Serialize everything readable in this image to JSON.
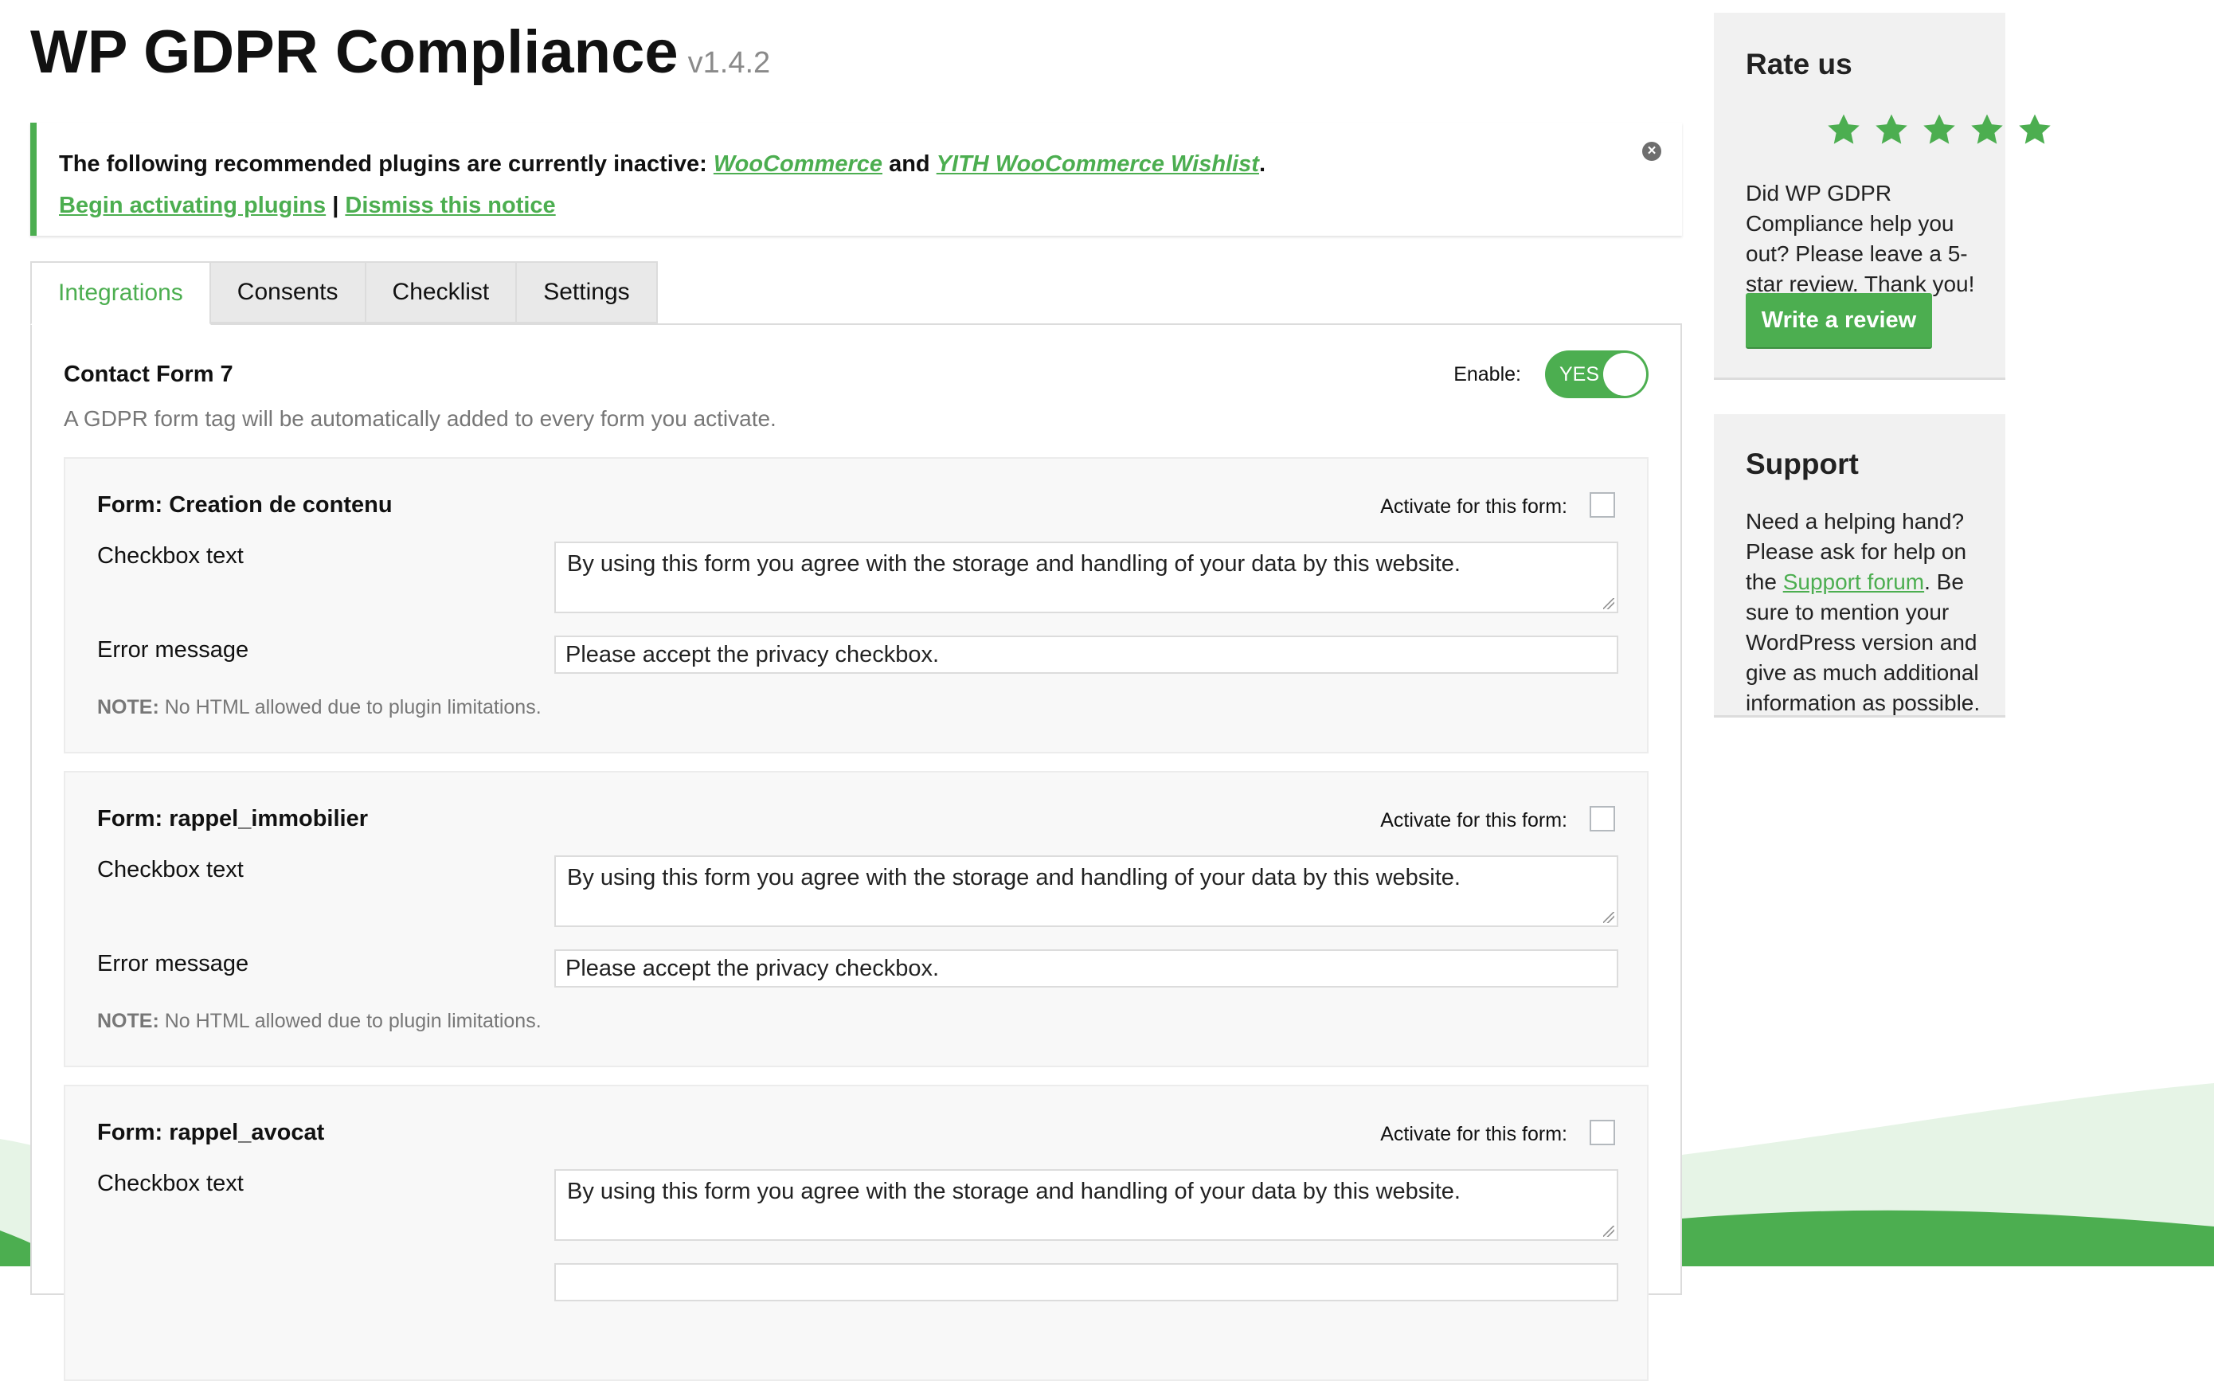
{
  "header": {
    "title": "WP GDPR Compliance",
    "version": "v1.4.2"
  },
  "notice": {
    "text_before": "The following recommended plugins are currently inactive: ",
    "plugin1": "WooCommerce",
    "and": " and ",
    "plugin2": "YITH WooCommerce Wishlist",
    "period": ".",
    "begin_link": "Begin activating plugins",
    "separator": " | ",
    "dismiss_link": "Dismiss this notice"
  },
  "tabs": [
    {
      "label": "Integrations",
      "active": true
    },
    {
      "label": "Consents",
      "active": false
    },
    {
      "label": "Checklist",
      "active": false
    },
    {
      "label": "Settings",
      "active": false
    }
  ],
  "integration": {
    "title": "Contact Form 7",
    "description": "A GDPR form tag will be automatically added to every form you activate.",
    "enable_label": "Enable:",
    "toggle_value": "YES",
    "enabled": true
  },
  "forms": [
    {
      "title": "Form: Creation de contenu",
      "activate_label": "Activate for this form:",
      "activated": false,
      "checkbox_label": "Checkbox text",
      "checkbox_text": "By using this form you agree with the storage and handling of your data by this website.",
      "error_label": "Error message",
      "error_text": "Please accept the privacy checkbox.",
      "note_prefix": "NOTE:",
      "note_text": " No HTML allowed due to plugin limitations."
    },
    {
      "title": "Form: rappel_immobilier",
      "activate_label": "Activate for this form:",
      "activated": false,
      "checkbox_label": "Checkbox text",
      "checkbox_text": "By using this form you agree with the storage and handling of your data by this website.",
      "error_label": "Error message",
      "error_text": "Please accept the privacy checkbox.",
      "note_prefix": "NOTE:",
      "note_text": " No HTML allowed due to plugin limitations."
    },
    {
      "title": "Form: rappel_avocat",
      "activate_label": "Activate for this form:",
      "activated": false,
      "checkbox_label": "Checkbox text",
      "checkbox_text": "By using this form you agree with the storage and handling of your data by this website."
    }
  ],
  "sidebar": {
    "rate": {
      "title": "Rate us",
      "stars": 5,
      "text": "Did WP GDPR Compliance help you out? Please leave a 5-star review. Thank you!",
      "button": "Write a review"
    },
    "support": {
      "title": "Support",
      "text_before": "Need a helping hand? Please ask for help on the ",
      "link": "Support forum",
      "text_after": ". Be sure to mention your WordPress version and give as much additional information as possible."
    }
  },
  "icons": {
    "notice_close": "close-circle-icon",
    "star": "star-icon",
    "resize": "resize-grip-icon"
  },
  "colors": {
    "accent": "#4cae50",
    "wave_light": "#e4f3e4",
    "wave_dark": "#4cae50"
  }
}
